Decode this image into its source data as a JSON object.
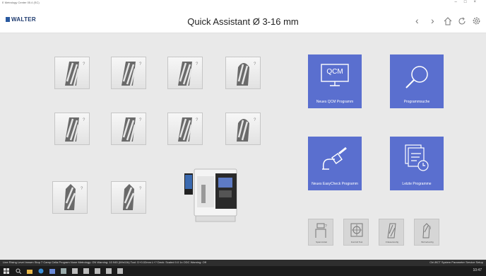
{
  "window": {
    "title": "E Metrology Center 05.4 (SC)"
  },
  "header": {
    "logo": "WALTER",
    "title": "Quick Assistant Ø 3-16 mm"
  },
  "tools": [
    {
      "name": "tool-end-mill-1"
    },
    {
      "name": "tool-end-mill-2"
    },
    {
      "name": "tool-end-mill-3"
    },
    {
      "name": "tool-ball-mill-1"
    },
    {
      "name": "tool-end-mill-4"
    },
    {
      "name": "tool-end-mill-5"
    },
    {
      "name": "tool-end-mill-6"
    },
    {
      "name": "tool-ball-mill-2"
    },
    {
      "name": "tool-drill-1"
    },
    {
      "name": "tool-drill-2"
    }
  ],
  "tiles": {
    "new_qcm": {
      "icon_text": "QCM",
      "label": "Neues QCM Programm"
    },
    "search": {
      "label": "Programmsuche"
    },
    "easycheck": {
      "label": "Neues EasyCheck Programm"
    },
    "recent": {
      "label": "Letzte Programme"
    }
  },
  "small_tiles": [
    {
      "label": "Spannmittel"
    },
    {
      "label": "Kontroll Tool"
    },
    {
      "label": "Frässerkonfig"
    },
    {
      "label": "Bohrerkonfig"
    }
  ],
  "statusbar": {
    "left": "Line  Rising   Level  Innsen   Stop    7 Camp    Cella    Program  None    Metrology: ON    Warning:  10 945 (Win11b)   Tool:  D+0.02mm L+?   Deck:  Scaled 0.0 1x   ODC Warning:  Off",
    "right": "Ctrl-BCT   System Parameter   Service Setup"
  },
  "taskbar": {
    "time": "10:47"
  },
  "colors": {
    "tile": "#5a6fcf",
    "accent": "#1e3a6e"
  }
}
